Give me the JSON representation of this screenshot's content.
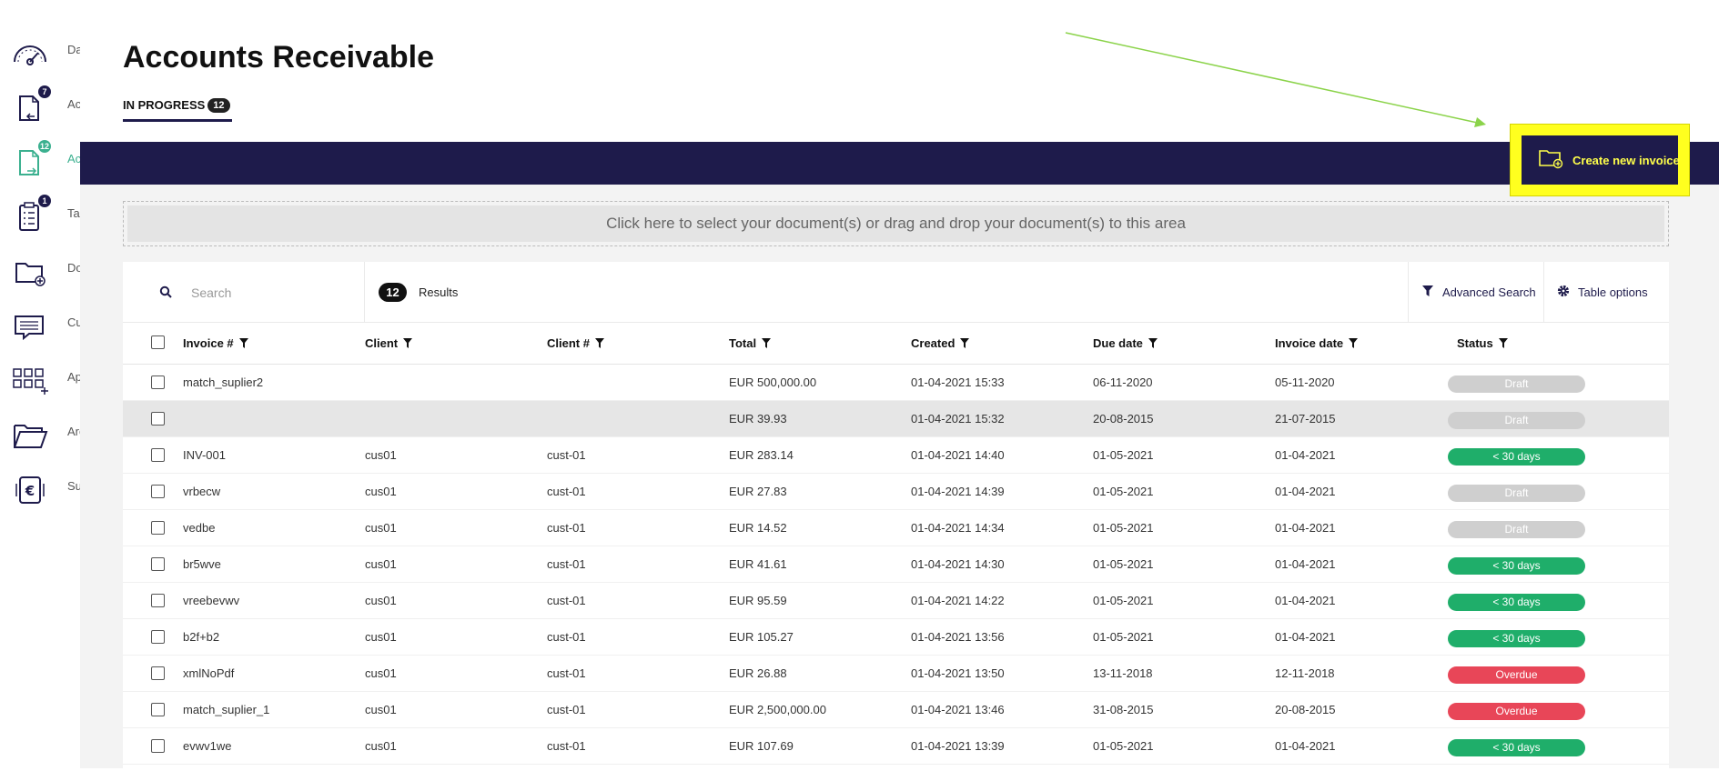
{
  "sidebar": {
    "items": [
      {
        "label": "Dashboard",
        "icon": "speedometer-icon",
        "badge": ""
      },
      {
        "label": "Accounts Payable",
        "icon": "inbound-document-icon",
        "badge": "7"
      },
      {
        "label": "Accounts Receivable",
        "icon": "outbound-document-icon",
        "badge": "12"
      },
      {
        "label": "Tasks",
        "icon": "task-list-icon",
        "badge": "1"
      },
      {
        "label": "Documents",
        "icon": "folder-add-icon",
        "badge": ""
      },
      {
        "label": "Customers",
        "icon": "chat-message-icon",
        "badge": ""
      },
      {
        "label": "Apps",
        "icon": "app-grid-icon",
        "badge": ""
      },
      {
        "label": "Archive",
        "icon": "open-folder-icon",
        "badge": ""
      },
      {
        "label": "Subscription",
        "icon": "euro-document-icon",
        "badge": ""
      }
    ]
  },
  "header": {
    "title": "Accounts Receivable",
    "tab": {
      "label": "IN PROGRESS",
      "count": "12"
    }
  },
  "create_button": {
    "label": "Create new invoice",
    "icon": "folder-add-icon"
  },
  "dropzone": {
    "text": "Click here to select your document(s) or drag and drop your document(s) to this area"
  },
  "toolbar": {
    "search_placeholder": "Search",
    "results_count": "12",
    "results_label": "Results",
    "advanced_search": "Advanced Search",
    "table_options": "Table options"
  },
  "table": {
    "columns": [
      "Invoice #",
      "Client",
      "Client #",
      "Total",
      "Created",
      "Due date",
      "Invoice date",
      "Status"
    ],
    "rows": [
      {
        "invoice": "match_suplier2",
        "client": "",
        "client_no": "",
        "total": "EUR 500,000.00",
        "created": "01-04-2021 15:33",
        "due": "06-11-2020",
        "invoice_date": "05-11-2020",
        "status": "Draft"
      },
      {
        "invoice": "",
        "client": "",
        "client_no": "",
        "total": "EUR 39.93",
        "created": "01-04-2021 15:32",
        "due": "20-08-2015",
        "invoice_date": "21-07-2015",
        "status": "Draft"
      },
      {
        "invoice": "INV-001",
        "client": "cus01",
        "client_no": "cust-01",
        "total": "EUR 283.14",
        "created": "01-04-2021 14:40",
        "due": "01-05-2021",
        "invoice_date": "01-04-2021",
        "status": "< 30 days"
      },
      {
        "invoice": "vrbecw",
        "client": "cus01",
        "client_no": "cust-01",
        "total": "EUR 27.83",
        "created": "01-04-2021 14:39",
        "due": "01-05-2021",
        "invoice_date": "01-04-2021",
        "status": "Draft"
      },
      {
        "invoice": "vedbe",
        "client": "cus01",
        "client_no": "cust-01",
        "total": "EUR 14.52",
        "created": "01-04-2021 14:34",
        "due": "01-05-2021",
        "invoice_date": "01-04-2021",
        "status": "Draft"
      },
      {
        "invoice": "br5wve",
        "client": "cus01",
        "client_no": "cust-01",
        "total": "EUR 41.61",
        "created": "01-04-2021 14:30",
        "due": "01-05-2021",
        "invoice_date": "01-04-2021",
        "status": "< 30 days"
      },
      {
        "invoice": "vreebevwv",
        "client": "cus01",
        "client_no": "cust-01",
        "total": "EUR 95.59",
        "created": "01-04-2021 14:22",
        "due": "01-05-2021",
        "invoice_date": "01-04-2021",
        "status": "< 30 days"
      },
      {
        "invoice": "b2f+b2",
        "client": "cus01",
        "client_no": "cust-01",
        "total": "EUR 105.27",
        "created": "01-04-2021 13:56",
        "due": "01-05-2021",
        "invoice_date": "01-04-2021",
        "status": "< 30 days"
      },
      {
        "invoice": "xmlNoPdf",
        "client": "cus01",
        "client_no": "cust-01",
        "total": "EUR 26.88",
        "created": "01-04-2021 13:50",
        "due": "13-11-2018",
        "invoice_date": "12-11-2018",
        "status": "Overdue"
      },
      {
        "invoice": "match_suplier_1",
        "client": "cus01",
        "client_no": "cust-01",
        "total": "EUR 2,500,000.00",
        "created": "01-04-2021 13:46",
        "due": "31-08-2015",
        "invoice_date": "20-08-2015",
        "status": "Overdue"
      },
      {
        "invoice": "evwv1we",
        "client": "cus01",
        "client_no": "cust-01",
        "total": "EUR 107.69",
        "created": "01-04-2021 13:39",
        "due": "01-05-2021",
        "invoice_date": "01-04-2021",
        "status": "< 30 days"
      }
    ]
  },
  "colors": {
    "navy": "#1e1b4b",
    "accent_teal": "#3bb08f",
    "highlight_yellow": "#ffff1f",
    "status_ok": "#1fae6a",
    "status_overdue": "#e84658",
    "status_draft": "#cfcfcf"
  }
}
